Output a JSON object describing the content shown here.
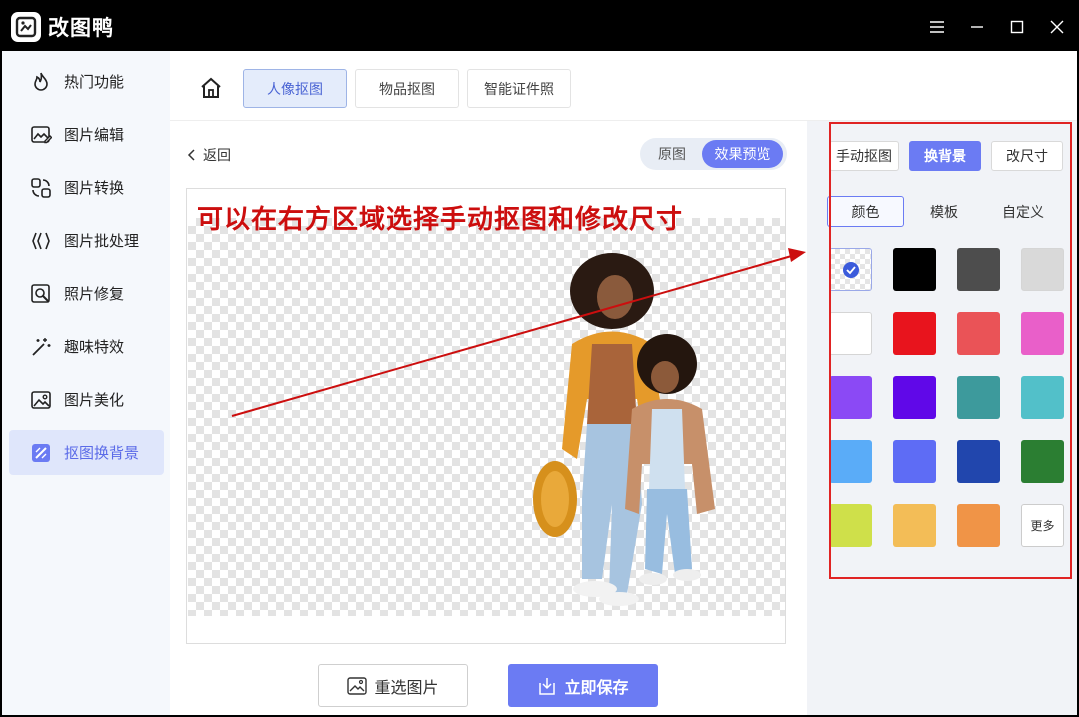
{
  "app": {
    "title": "改图鸭"
  },
  "sidebar": {
    "items": [
      {
        "label": "热门功能",
        "icon": "flame-icon"
      },
      {
        "label": "图片编辑",
        "icon": "image-edit-icon"
      },
      {
        "label": "图片转换",
        "icon": "convert-icon"
      },
      {
        "label": "图片批处理",
        "icon": "batch-icon"
      },
      {
        "label": "照片修复",
        "icon": "photo-repair-icon"
      },
      {
        "label": "趣味特效",
        "icon": "magic-wand-icon"
      },
      {
        "label": "图片美化",
        "icon": "image-beautify-icon"
      },
      {
        "label": "抠图换背景",
        "icon": "cutout-icon",
        "active": true
      }
    ]
  },
  "top_tabs": [
    {
      "label": "人像抠图",
      "active": true
    },
    {
      "label": "物品抠图"
    },
    {
      "label": "智能证件照"
    }
  ],
  "main": {
    "back_label": "返回",
    "view_toggle": {
      "original": "原图",
      "preview": "效果预览",
      "selected": "preview"
    },
    "annotation_text": "可以在右方区域选择手动抠图和修改尺寸",
    "reselect_label": "重选图片",
    "save_label": "立即保存"
  },
  "right_panel": {
    "modes": [
      {
        "label": "手动抠图"
      },
      {
        "label": "换背景",
        "active": true
      },
      {
        "label": "改尺寸"
      }
    ],
    "sub_tabs": [
      {
        "label": "颜色",
        "active": true
      },
      {
        "label": "模板"
      },
      {
        "label": "自定义"
      }
    ],
    "colors": [
      "transparent",
      "#000000",
      "#4d4d4d",
      "#d9d9d9",
      "#ffffff",
      "#e8141d",
      "#ea5357",
      "#e95fc9",
      "#8b49f5",
      "#6008e8",
      "#3d9a9c",
      "#52c0c9",
      "#5aacf8",
      "#5e6cf5",
      "#2146ad",
      "#2b7e32",
      "#cfe04a",
      "#f3bd57",
      "#f09447"
    ],
    "selected_color": "transparent",
    "more_label": "更多"
  },
  "colors": {
    "accent": "#6b7bf3",
    "annotation": "#cc0e0e",
    "highlight_box": "#e02323"
  }
}
